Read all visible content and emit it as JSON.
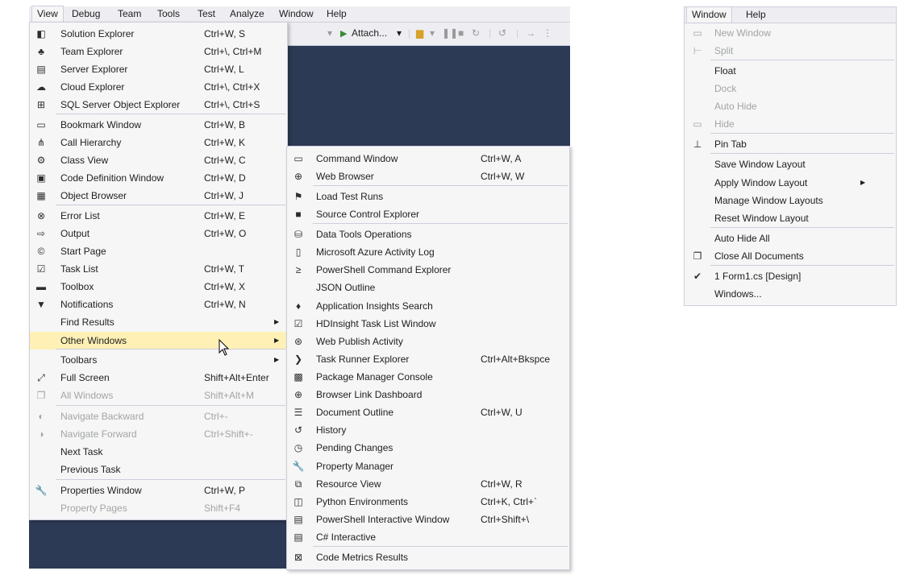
{
  "menubar": {
    "items": [
      "View",
      "Debug",
      "Team",
      "Tools",
      "Test",
      "Analyze",
      "Window",
      "Help"
    ]
  },
  "toolbar": {
    "attach_label": "Attach...",
    "attach_arrow": "▾"
  },
  "view_menu": {
    "items": [
      {
        "label": "Solution Explorer",
        "shortcut": "Ctrl+W, S",
        "icon": "solution-explorer-icon",
        "glyph": "◧"
      },
      {
        "label": "Team Explorer",
        "shortcut": "Ctrl+\\, Ctrl+M",
        "icon": "team-explorer-icon",
        "glyph": "♣"
      },
      {
        "label": "Server Explorer",
        "shortcut": "Ctrl+W, L",
        "icon": "server-explorer-icon",
        "glyph": "▤"
      },
      {
        "label": "Cloud Explorer",
        "shortcut": "Ctrl+\\, Ctrl+X",
        "icon": "cloud-icon",
        "glyph": "☁"
      },
      {
        "label": "SQL Server Object Explorer",
        "shortcut": "Ctrl+\\, Ctrl+S",
        "icon": "sql-server-icon",
        "glyph": "⊞"
      },
      {
        "label": "Bookmark Window",
        "shortcut": "Ctrl+W, B",
        "icon": "bookmark-icon",
        "glyph": "▭"
      },
      {
        "label": "Call Hierarchy",
        "shortcut": "Ctrl+W, K",
        "icon": "call-hierarchy-icon",
        "glyph": "⋔"
      },
      {
        "label": "Class View",
        "shortcut": "Ctrl+W, C",
        "icon": "class-view-icon",
        "glyph": "⚙"
      },
      {
        "label": "Code Definition Window",
        "shortcut": "Ctrl+W, D",
        "icon": "code-definition-icon",
        "glyph": "▣"
      },
      {
        "label": "Object Browser",
        "shortcut": "Ctrl+W, J",
        "icon": "object-browser-icon",
        "glyph": "▦"
      },
      {
        "label": "Error List",
        "shortcut": "Ctrl+W, E",
        "icon": "error-list-icon",
        "glyph": "⊗"
      },
      {
        "label": "Output",
        "shortcut": "Ctrl+W, O",
        "icon": "output-icon",
        "glyph": "⇨"
      },
      {
        "label": "Start Page",
        "shortcut": "",
        "icon": "start-page-icon",
        "glyph": "©"
      },
      {
        "label": "Task List",
        "shortcut": "Ctrl+W, T",
        "icon": "task-list-icon",
        "glyph": "☑"
      },
      {
        "label": "Toolbox",
        "shortcut": "Ctrl+W, X",
        "icon": "toolbox-icon",
        "glyph": "▬"
      },
      {
        "label": "Notifications",
        "shortcut": "Ctrl+W, N",
        "icon": "notifications-icon",
        "glyph": "▼"
      },
      {
        "label": "Find Results",
        "shortcut": "",
        "icon": "",
        "glyph": "",
        "submenu": true
      },
      {
        "label": "Other Windows",
        "shortcut": "",
        "icon": "",
        "glyph": "",
        "submenu": true,
        "highlighted": true
      },
      {
        "label": "Toolbars",
        "shortcut": "",
        "icon": "",
        "glyph": "",
        "submenu": true
      },
      {
        "label": "Full Screen",
        "shortcut": "Shift+Alt+Enter",
        "icon": "full-screen-icon",
        "glyph": "⤢"
      },
      {
        "label": "All Windows",
        "shortcut": "Shift+Alt+M",
        "icon": "all-windows-icon",
        "glyph": "❐",
        "disabled": true
      },
      {
        "label": "Navigate Backward",
        "shortcut": "Ctrl+-",
        "icon": "navigate-backward-icon",
        "glyph": "◐",
        "disabled": true
      },
      {
        "label": "Navigate Forward",
        "shortcut": "Ctrl+Shift+-",
        "icon": "navigate-forward-icon",
        "glyph": "◑",
        "disabled": true
      },
      {
        "label": "Next Task",
        "shortcut": "",
        "icon": "",
        "glyph": ""
      },
      {
        "label": "Previous Task",
        "shortcut": "",
        "icon": "",
        "glyph": ""
      },
      {
        "label": "Properties Window",
        "shortcut": "Ctrl+W, P",
        "icon": "wrench-icon",
        "glyph": "🔧"
      },
      {
        "label": "Property Pages",
        "shortcut": "Shift+F4",
        "icon": "",
        "glyph": "",
        "disabled": true
      }
    ]
  },
  "other_windows_menu": {
    "items": [
      {
        "label": "Command Window",
        "shortcut": "Ctrl+W, A",
        "icon": "command-window-icon",
        "glyph": "▭"
      },
      {
        "label": "Web Browser",
        "shortcut": "Ctrl+W, W",
        "icon": "web-browser-icon",
        "glyph": "⊕"
      },
      {
        "label": "Load Test Runs",
        "shortcut": "",
        "icon": "load-test-icon",
        "glyph": "⚑"
      },
      {
        "label": "Source Control Explorer",
        "shortcut": "",
        "icon": "source-control-icon",
        "glyph": "■"
      },
      {
        "label": "Data Tools Operations",
        "shortcut": "",
        "icon": "data-tools-icon",
        "glyph": "⛁"
      },
      {
        "label": "Microsoft Azure Activity Log",
        "shortcut": "",
        "icon": "azure-log-icon",
        "glyph": "▯"
      },
      {
        "label": "PowerShell Command Explorer",
        "shortcut": "",
        "icon": "powershell-icon",
        "glyph": "≥"
      },
      {
        "label": "JSON Outline",
        "shortcut": "",
        "icon": "",
        "glyph": ""
      },
      {
        "label": "Application Insights Search",
        "shortcut": "",
        "icon": "app-insights-icon",
        "glyph": "♦"
      },
      {
        "label": "HDInsight Task List Window",
        "shortcut": "",
        "icon": "hdinsight-icon",
        "glyph": "☑"
      },
      {
        "label": "Web Publish Activity",
        "shortcut": "",
        "icon": "web-publish-icon",
        "glyph": "⊛"
      },
      {
        "label": "Task Runner Explorer",
        "shortcut": "Ctrl+Alt+Bkspce",
        "icon": "task-runner-icon",
        "glyph": "❯"
      },
      {
        "label": "Package Manager Console",
        "shortcut": "",
        "icon": "package-manager-icon",
        "glyph": "▩"
      },
      {
        "label": "Browser Link Dashboard",
        "shortcut": "",
        "icon": "browser-link-icon",
        "glyph": "⊕"
      },
      {
        "label": "Document Outline",
        "shortcut": "Ctrl+W, U",
        "icon": "document-outline-icon",
        "glyph": "☰"
      },
      {
        "label": "History",
        "shortcut": "",
        "icon": "history-icon",
        "glyph": "↺"
      },
      {
        "label": "Pending Changes",
        "shortcut": "",
        "icon": "pending-changes-icon",
        "glyph": "◷"
      },
      {
        "label": "Property Manager",
        "shortcut": "",
        "icon": "property-manager-icon",
        "glyph": "🔧"
      },
      {
        "label": "Resource View",
        "shortcut": "Ctrl+W, R",
        "icon": "resource-view-icon",
        "glyph": "⧉"
      },
      {
        "label": "Python Environments",
        "shortcut": "Ctrl+K, Ctrl+`",
        "icon": "python-env-icon",
        "glyph": "◫"
      },
      {
        "label": "PowerShell Interactive Window",
        "shortcut": "Ctrl+Shift+\\",
        "icon": "powershell-interactive-icon",
        "glyph": "▤"
      },
      {
        "label": "C# Interactive",
        "shortcut": "",
        "icon": "csharp-interactive-icon",
        "glyph": "▤"
      },
      {
        "label": "Code Metrics Results",
        "shortcut": "",
        "icon": "code-metrics-icon",
        "glyph": "⊠"
      }
    ]
  },
  "window_menu": {
    "menubar": [
      "Window",
      "Help"
    ],
    "items": [
      {
        "label": "New Window",
        "icon": "new-window-icon",
        "glyph": "▭",
        "disabled": true
      },
      {
        "label": "Split",
        "icon": "split-icon",
        "glyph": "⊢",
        "disabled": true
      },
      {
        "label": "Float",
        "icon": "",
        "glyph": ""
      },
      {
        "label": "Dock",
        "icon": "",
        "glyph": "",
        "disabled": true
      },
      {
        "label": "Auto Hide",
        "icon": "",
        "glyph": "",
        "disabled": true
      },
      {
        "label": "Hide",
        "icon": "hide-icon",
        "glyph": "▭",
        "disabled": true
      },
      {
        "label": "Pin Tab",
        "icon": "pin-icon",
        "glyph": "⊥"
      },
      {
        "label": "Save Window Layout",
        "icon": "",
        "glyph": ""
      },
      {
        "label": "Apply Window Layout",
        "icon": "",
        "glyph": "",
        "submenu": true
      },
      {
        "label": "Manage Window Layouts",
        "icon": "",
        "glyph": ""
      },
      {
        "label": "Reset Window Layout",
        "icon": "",
        "glyph": ""
      },
      {
        "label": "Auto Hide All",
        "icon": "",
        "glyph": ""
      },
      {
        "label": "Close All Documents",
        "icon": "close-all-icon",
        "glyph": "❐"
      },
      {
        "label": "1 Form1.cs [Design]",
        "icon": "checkmark-icon",
        "glyph": "✔"
      },
      {
        "label": "Windows...",
        "icon": "",
        "glyph": ""
      }
    ]
  },
  "colors": {
    "menu_bg": "#f6f6f6",
    "highlight": "#fff0b6",
    "ide_background": "#2d3a55",
    "disabled_text": "#a2a4a5"
  }
}
